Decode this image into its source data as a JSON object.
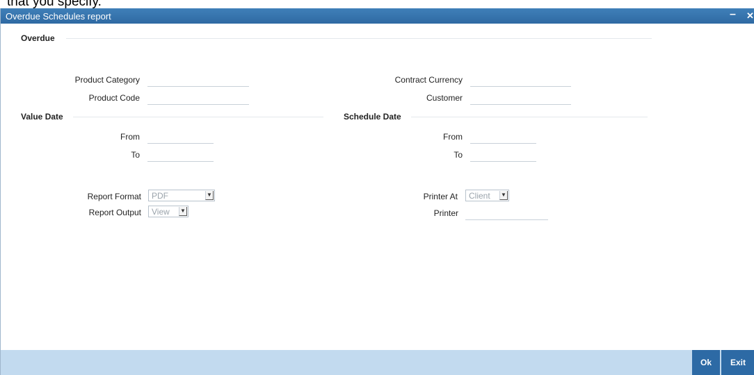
{
  "page_text": "that you specify.",
  "window": {
    "title": "Overdue Schedules report",
    "minimize_glyph": "–",
    "close_glyph": "✕"
  },
  "sections": {
    "overdue": "Overdue",
    "value_date": "Value Date",
    "schedule_date": "Schedule Date"
  },
  "fields": {
    "product_category": {
      "label": "Product Category",
      "value": ""
    },
    "product_code": {
      "label": "Product Code",
      "value": ""
    },
    "contract_currency": {
      "label": "Contract Currency",
      "value": ""
    },
    "customer": {
      "label": "Customer",
      "value": ""
    },
    "value_from": {
      "label": "From",
      "value": ""
    },
    "value_to": {
      "label": "To",
      "value": ""
    },
    "schedule_from": {
      "label": "From",
      "value": ""
    },
    "schedule_to": {
      "label": "To",
      "value": ""
    },
    "printer": {
      "label": "Printer",
      "value": ""
    }
  },
  "selects": {
    "report_format": {
      "label": "Report Format",
      "value": "PDF"
    },
    "report_output": {
      "label": "Report Output",
      "value": "View"
    },
    "printer_at": {
      "label": "Printer At",
      "value": "Client"
    }
  },
  "buttons": {
    "ok": "Ok",
    "exit": "Exit"
  },
  "dropdown_arrow": "▼"
}
